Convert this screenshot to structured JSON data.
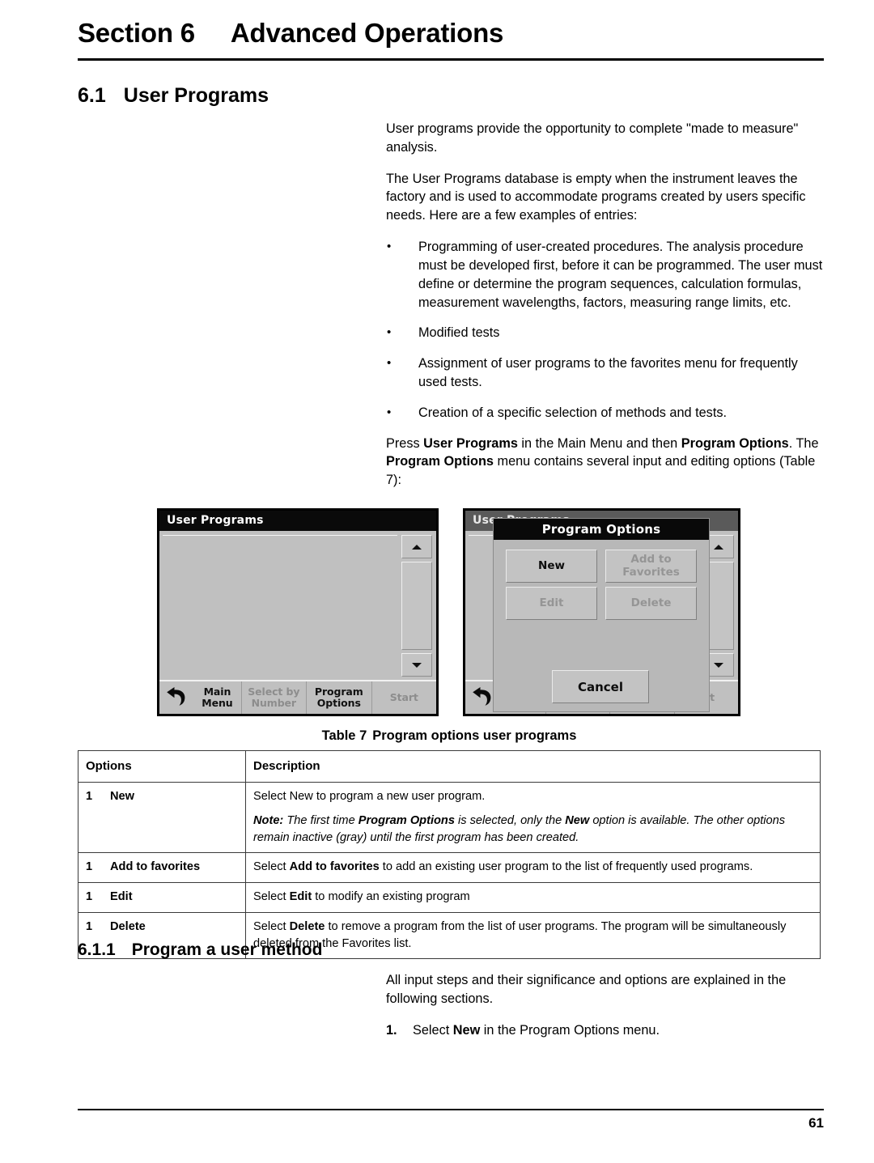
{
  "header": {
    "section_label": "Section 6",
    "section_title": "Advanced Operations"
  },
  "headings": {
    "h2_number": "6.1",
    "h2_title": "User Programs",
    "h3_number": "6.1.1",
    "h3_title": "Program a user method"
  },
  "body": {
    "p1": "User programs provide the opportunity to complete \"made to measure\" analysis.",
    "p2": "The User Programs database is empty when the instrument leaves the factory and is used to accommodate programs created by users specific needs. Here are a few examples of entries:",
    "bullets": [
      "Programming of user-created procedures. The analysis procedure must be developed first, before it can be programmed. The user must define or determine the program sequences, calculation formulas, measurement wavelengths, factors, measuring range limits, etc.",
      "Modified tests",
      "Assignment of user programs to the favorites menu for frequently used tests.",
      "Creation of a specific selection of methods and tests."
    ],
    "press_intro": "Press ",
    "press_b1": "User Programs",
    "press_mid1": " in the Main Menu and then ",
    "press_b2": "Program Options",
    "press_mid2": ". The ",
    "press_b3": "Program Options",
    "press_tail": " menu contains several input and editing options (Table 7):",
    "p_after_h3": "All input steps and their significance and options are explained in the following sections.",
    "step1_num": "1.",
    "step1_pre": "Select ",
    "step1_bold": "New",
    "step1_post": " in the Program Options menu."
  },
  "screenshot1": {
    "title": "User Programs",
    "toolbar": [
      {
        "label": "Main\nMenu",
        "disabled": false,
        "icon": "back-arrow-icon"
      },
      {
        "label": "Select by\nNumber",
        "disabled": true
      },
      {
        "label": "Program\nOptions",
        "disabled": false
      },
      {
        "label": "Start",
        "disabled": true
      }
    ],
    "scroll_up_icon": "triangle-up-icon",
    "scroll_down_icon": "triangle-down-icon"
  },
  "screenshot2": {
    "title": "User Programs",
    "dialog": {
      "title": "Program Options",
      "buttons": [
        {
          "label": "New",
          "disabled": false
        },
        {
          "label": "Add to\nFavorites",
          "disabled": true
        },
        {
          "label": "Edit",
          "disabled": true
        },
        {
          "label": "Delete",
          "disabled": true
        }
      ],
      "cancel_label": "Cancel"
    },
    "toolbar_visible_label": "art",
    "scroll_up_icon": "triangle-up-icon",
    "scroll_down_icon": "triangle-down-icon"
  },
  "table": {
    "caption_number": "Table 7",
    "caption_text": "Program options user programs",
    "headers": [
      "Options",
      "Description"
    ],
    "rows": [
      {
        "index": "1",
        "option": "New",
        "desc_main": "Select New to program a new user program.",
        "note_label": "Note:",
        "note_part1": " The first time ",
        "note_b1": "Program Options",
        "note_part2": " is selected, only the ",
        "note_b2": "New",
        "note_part3": " option is available. The other options remain inactive (gray) until the first program has been created."
      },
      {
        "index": "1",
        "option": "Add to favorites",
        "desc_pre": "Select ",
        "desc_bold": "Add to favorites",
        "desc_post": " to add an existing user program to the list of frequently used programs."
      },
      {
        "index": "1",
        "option": "Edit",
        "desc_pre": "Select ",
        "desc_bold": "Edit",
        "desc_post": " to modify an existing program"
      },
      {
        "index": "1",
        "option": "Delete",
        "desc_pre": "Select ",
        "desc_bold": "Delete",
        "desc_post": " to remove a program from the list of user programs. The program will be simultaneously deleted from the Favorites list."
      }
    ]
  },
  "footer": {
    "page_number": "61"
  },
  "colors": {
    "titlebar": "#0a0a0a",
    "device_bg": "#c0c0c0",
    "disabled_text": "#8d8d8d"
  }
}
